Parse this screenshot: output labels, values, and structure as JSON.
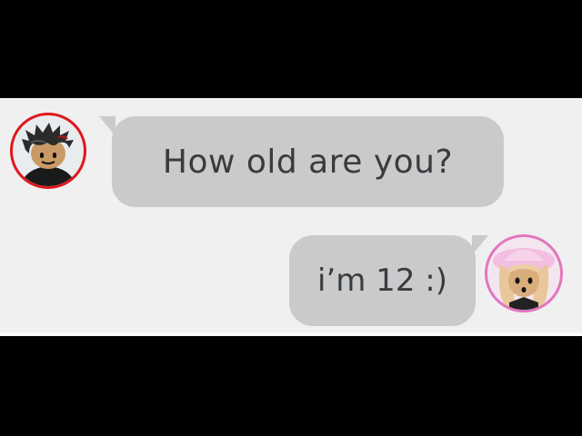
{
  "conversation": {
    "messages": [
      {
        "sender": "other",
        "text": "How old are you?",
        "avatar_border_color": "#e0181c"
      },
      {
        "sender": "self",
        "text": "i’m 12 :)",
        "avatar_border_color": "#e276bd"
      }
    ],
    "bubble_color": "#c9cacc",
    "text_color": "#393b3d",
    "background_color": "#f0f0f1"
  }
}
